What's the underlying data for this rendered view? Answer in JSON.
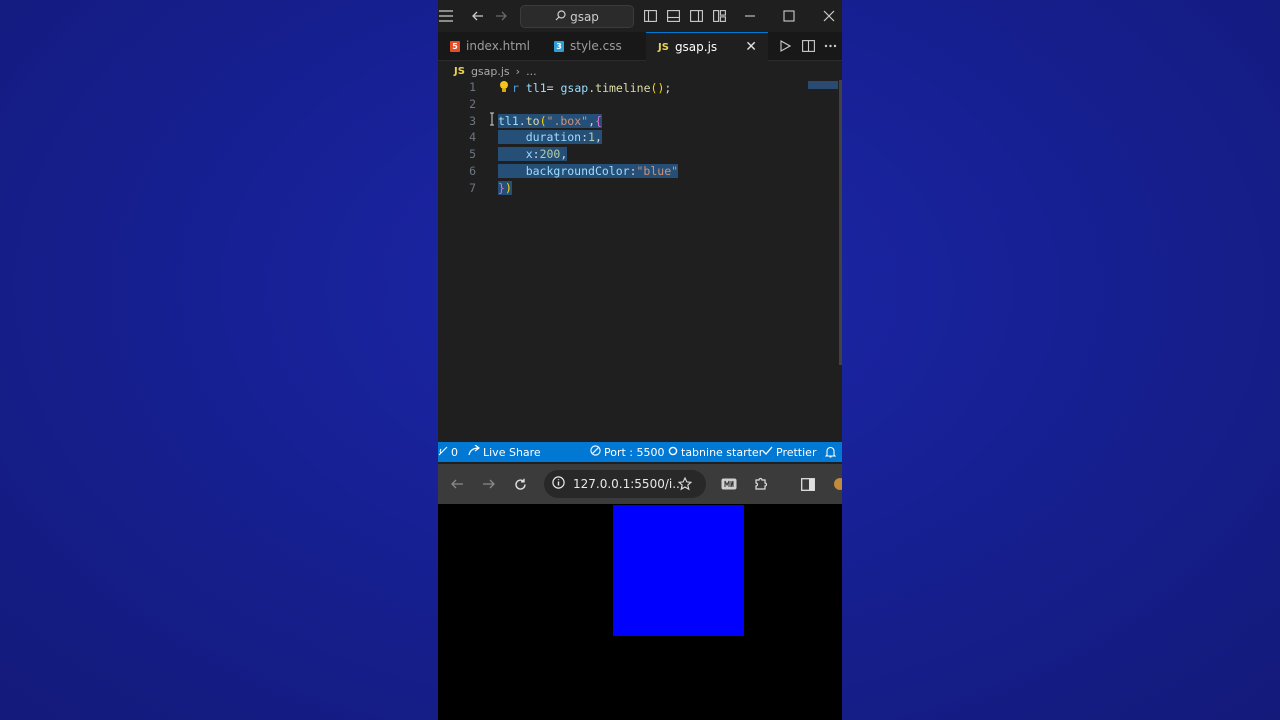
{
  "titlebar": {
    "search_label": "gsap"
  },
  "tabs": [
    {
      "label": "index.html",
      "badge": "5",
      "active": false
    },
    {
      "label": "style.css",
      "badge": "3",
      "active": false
    },
    {
      "label": "gsap.js",
      "badge": "JS",
      "active": true
    }
  ],
  "tab_close": "✕",
  "breadcrumb": {
    "badge": "JS",
    "file": "gsap.js",
    "sep": "›",
    "more": "..."
  },
  "editor": {
    "lines": [
      {
        "n": "1",
        "text": "var tl1= gsap.timeline();"
      },
      {
        "n": "2",
        "text": ""
      },
      {
        "n": "3",
        "text": "tl1.to(\".box\",{"
      },
      {
        "n": "4",
        "text": "    duration:1,"
      },
      {
        "n": "5",
        "text": "    x:200,"
      },
      {
        "n": "6",
        "text": "    backgroundColor:\"blue\""
      },
      {
        "n": "7",
        "text": "})"
      }
    ]
  },
  "statusbar": {
    "ports_count": "0",
    "live_share": "Live Share",
    "port": "Port : 5500",
    "tabnine": "tabnine starter",
    "prettier": "Prettier"
  },
  "browser": {
    "url": "127.0.0.1:5500/i..."
  },
  "preview": {
    "box_color": "#0000ff"
  },
  "colors": {
    "accent": "#0078d4",
    "background": "#1a1f8c"
  }
}
